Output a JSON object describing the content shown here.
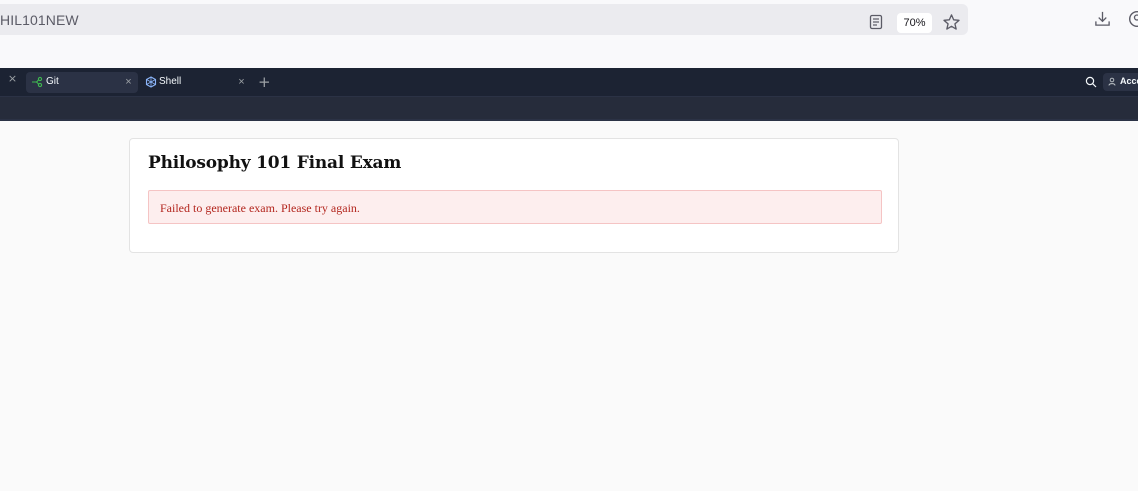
{
  "browser": {
    "url": "HIL101NEW",
    "zoom": "70%",
    "icons": {
      "reader": "reader-view-icon",
      "bookmark": "star-icon",
      "download": "download-icon",
      "account": "account-icon"
    }
  },
  "workspace": {
    "tabs": [
      {
        "label": "Git",
        "icon": "git-icon",
        "active": true
      },
      {
        "label": "Shell",
        "icon": "shell-icon",
        "active": false
      }
    ],
    "account_label": "Acce"
  },
  "exam": {
    "title": "Philosophy 101 Final Exam",
    "error_message": "Failed to generate exam. Please try again."
  },
  "colors": {
    "error_text": "#b3261e",
    "error_bg": "#fdeeee",
    "tabbar_bg": "#1c2333"
  }
}
